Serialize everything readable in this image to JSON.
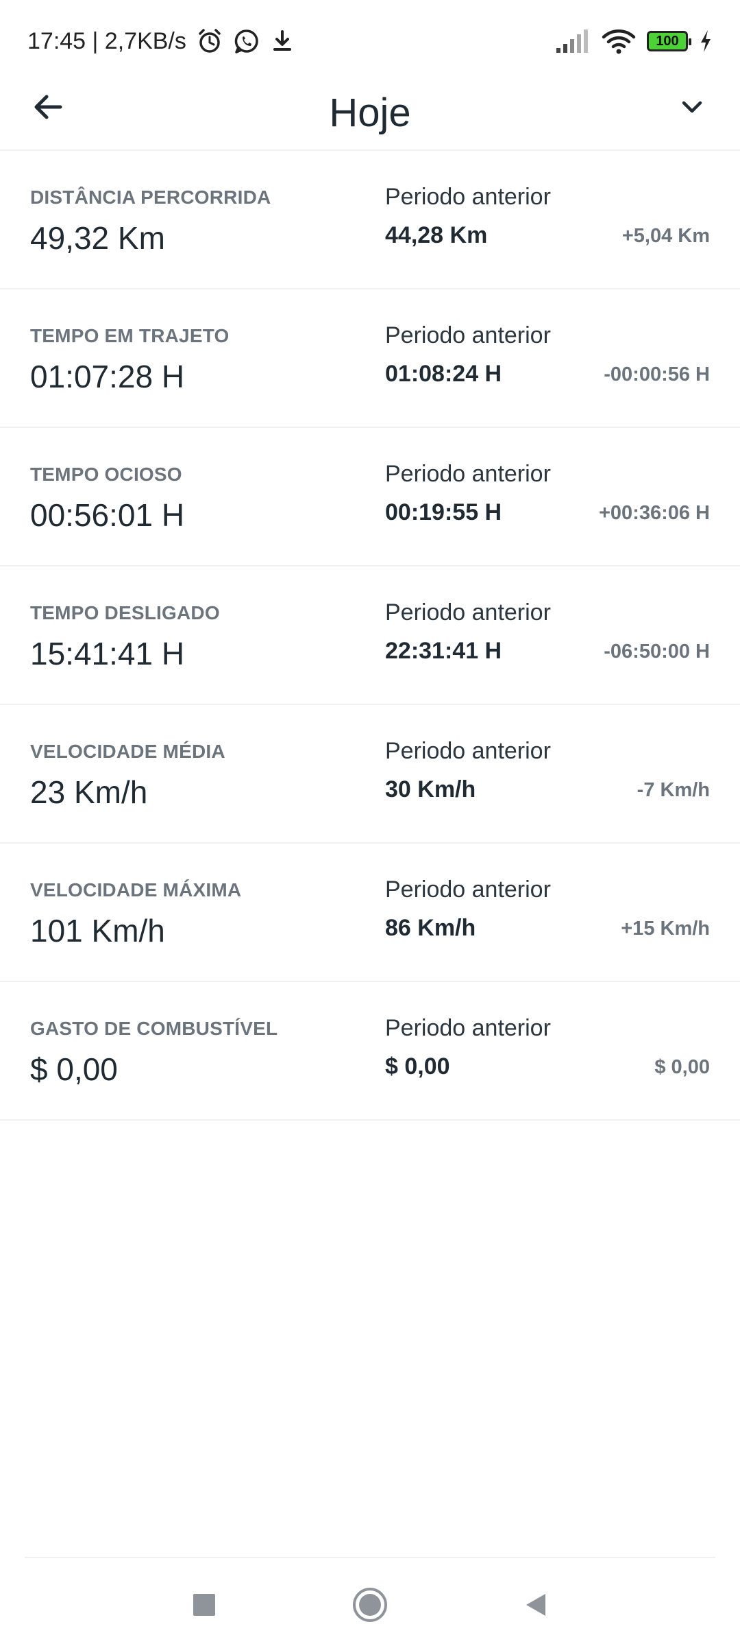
{
  "status_bar": {
    "time_speed": "17:45 | 2,7KB/s",
    "battery": "100",
    "icons": [
      "alarm-icon",
      "whatsapp-icon",
      "download-icon",
      "signal-icon",
      "wifi-icon",
      "battery-icon",
      "charging-icon"
    ]
  },
  "header": {
    "title": "Hoje",
    "back_icon": "arrow-left-icon",
    "dropdown_icon": "chevron-down-icon"
  },
  "metrics": [
    {
      "label": "DISTÂNCIA PERCORRIDA",
      "value": "49,32 Km",
      "prev_label": "Periodo anterior",
      "prev_value": "44,28 Km",
      "diff": "+5,04 Km"
    },
    {
      "label": "TEMPO EM TRAJETO",
      "value": "01:07:28 H",
      "prev_label": "Periodo anterior",
      "prev_value": "01:08:24 H",
      "diff": "-00:00:56 H"
    },
    {
      "label": "TEMPO OCIOSO",
      "value": "00:56:01 H",
      "prev_label": "Periodo anterior",
      "prev_value": "00:19:55 H",
      "diff": "+00:36:06 H"
    },
    {
      "label": "TEMPO DESLIGADO",
      "value": "15:41:41 H",
      "prev_label": "Periodo anterior",
      "prev_value": "22:31:41 H",
      "diff": "-06:50:00 H"
    },
    {
      "label": "VELOCIDADE MÉDIA",
      "value": "23 Km/h",
      "prev_label": "Periodo anterior",
      "prev_value": "30 Km/h",
      "diff": "-7 Km/h"
    },
    {
      "label": "VELOCIDADE MÁXIMA",
      "value": "101 Km/h",
      "prev_label": "Periodo anterior",
      "prev_value": "86 Km/h",
      "diff": "+15 Km/h"
    },
    {
      "label": "GASTO DE COMBUSTÍVEL",
      "value": "$ 0,00",
      "prev_label": "Periodo anterior",
      "prev_value": "$ 0,00",
      "diff": "$ 0,00"
    }
  ],
  "nav_bar": {
    "icons": [
      "recents-square-icon",
      "home-circle-icon",
      "back-triangle-icon"
    ]
  },
  "colors": {
    "text_primary": "#1f2a33",
    "text_muted": "#6b747c",
    "divider": "#eef0f2",
    "battery_fill": "#4cd137"
  }
}
